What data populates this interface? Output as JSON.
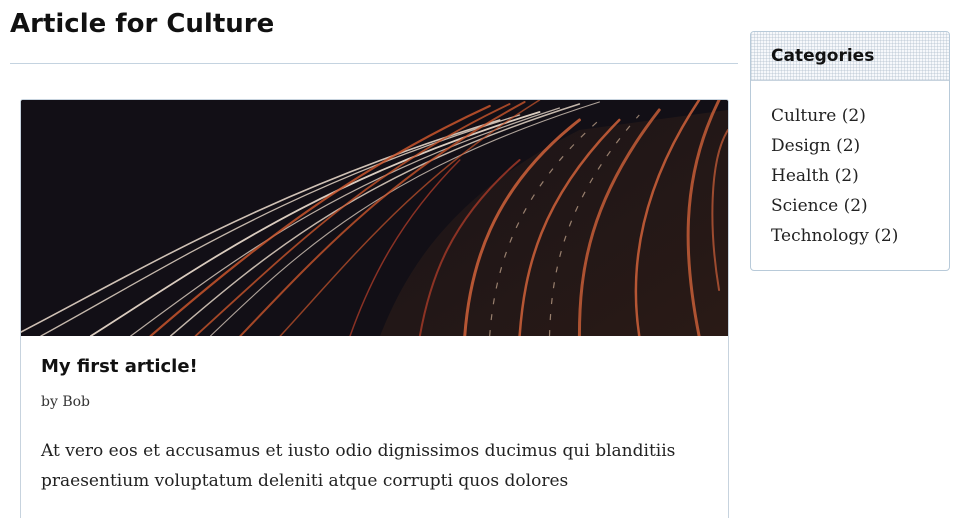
{
  "page": {
    "title": "Article for Culture"
  },
  "article": {
    "title": "My first article!",
    "byline": "by Bob",
    "excerpt": "At vero eos et accusamus et iusto odio dignissimos ducimus qui blanditiis praesentium voluptatum deleniti atque corrupti quos dolores"
  },
  "categories": {
    "title": "Categories",
    "items": [
      {
        "label": "Culture (2)"
      },
      {
        "label": "Design (2)"
      },
      {
        "label": "Health (2)"
      },
      {
        "label": "Science (2)"
      },
      {
        "label": "Technology (2)"
      }
    ]
  },
  "colors": {
    "border": "#c7d3de",
    "image_background": "#120f16",
    "light_trail_orange": "#c9552c",
    "light_trail_white": "#f4e6d8"
  }
}
